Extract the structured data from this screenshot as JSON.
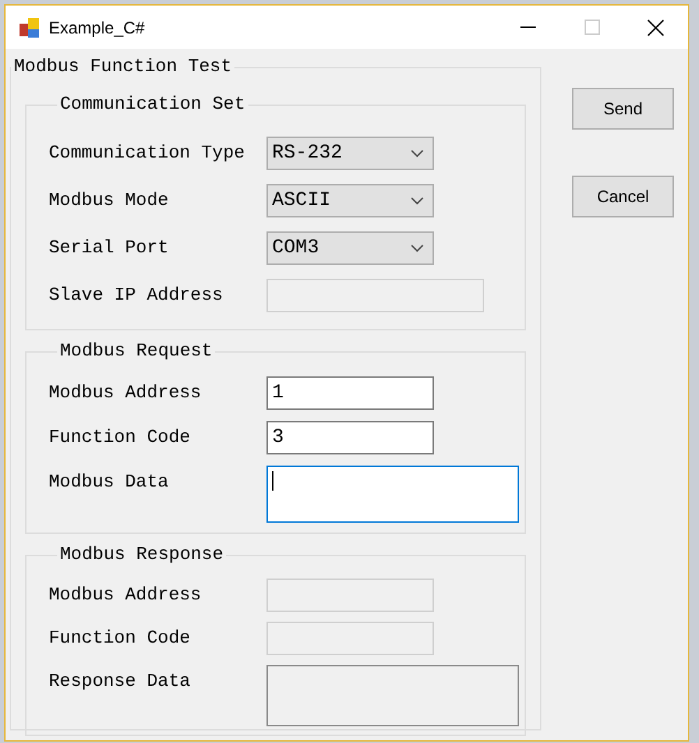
{
  "window": {
    "title": "Example_C#",
    "maximize_disabled": true
  },
  "group": {
    "title": "Modbus Function Test",
    "sections": [
      {
        "title": "Communication Set",
        "rows": [
          {
            "label": "Communication Type",
            "kind": "dropdown",
            "value": "RS-232"
          },
          {
            "label": "Modbus Mode",
            "kind": "dropdown",
            "value": "ASCII"
          },
          {
            "label": "Serial Port",
            "kind": "dropdown",
            "value": "COM3"
          },
          {
            "label": "Slave IP Address",
            "kind": "textbox",
            "wide": true,
            "disabled": true
          }
        ]
      },
      {
        "title": "Modbus Request",
        "rows": [
          {
            "label": "Modbus Address",
            "kind": "textbox",
            "value": "1",
            "disabled": false
          },
          {
            "label": "Function Code",
            "kind": "textbox",
            "value": "3",
            "disabled": false
          },
          {
            "label": "Modbus Data",
            "kind": "textarea",
            "focused": true,
            "disabled": false
          }
        ]
      },
      {
        "title": "Modbus Response",
        "rows": [
          {
            "label": "Modbus Address",
            "kind": "textbox",
            "disabled": true
          },
          {
            "label": "Function Code",
            "kind": "textbox",
            "disabled": true
          },
          {
            "label": "Response Data",
            "kind": "textarea",
            "focused": false,
            "disabled": true
          }
        ]
      }
    ]
  },
  "buttons": [
    "Send",
    "Cancel"
  ]
}
